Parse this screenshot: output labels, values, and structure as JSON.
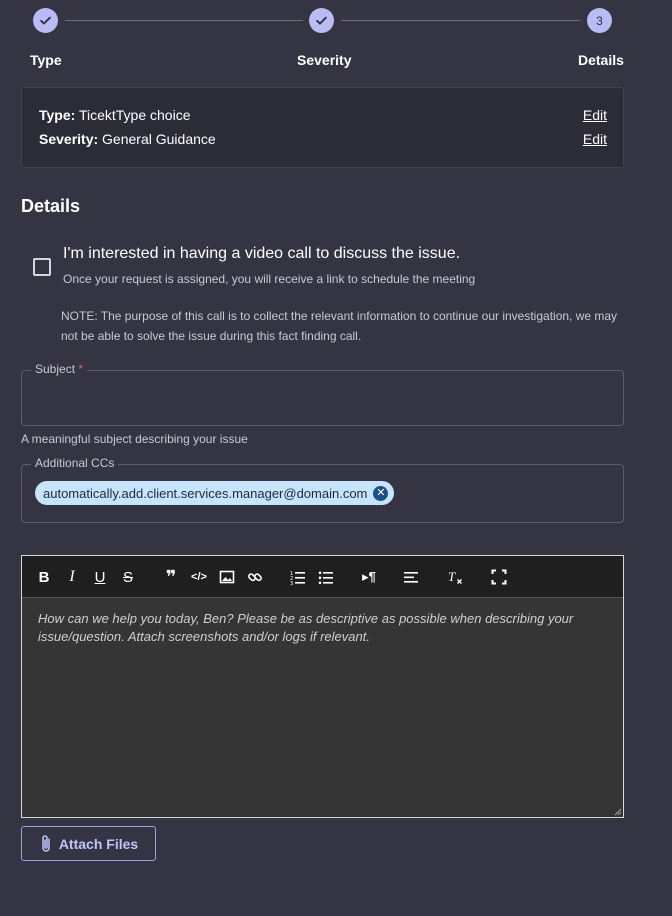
{
  "stepper": {
    "steps": [
      {
        "label": "Type",
        "state": "complete"
      },
      {
        "label": "Severity",
        "state": "complete"
      },
      {
        "label": "Details",
        "state": "current",
        "number": "3"
      }
    ]
  },
  "summary": {
    "type_key": "Type:",
    "type_value": " TicektType choice",
    "severity_key": "Severity:",
    "severity_value": " General Guidance",
    "edit_label": "Edit"
  },
  "details": {
    "title": "Details",
    "video_call": {
      "label": "I'm interested in having a video call to discuss the issue.",
      "sublabel": "Once your request is assigned, you will receive a link to schedule the meeting",
      "checked": false
    },
    "note": "NOTE: The purpose of this call is to collect the relevant information to continue our investigation, we may not be able to solve the issue during this fact finding call."
  },
  "subject": {
    "label": "Subject",
    "required_mark": "*",
    "value": "",
    "helper": "A meaningful subject describing your issue"
  },
  "ccs": {
    "label": "Additional CCs",
    "chips": [
      "automatically.add.client.services.manager@domain.com"
    ]
  },
  "editor": {
    "placeholder": "How can we help you today, Ben? Please be as descriptive as possible when describing your issue/question. Attach screenshots and/or logs if relevant.",
    "toolbar": [
      "bold-icon",
      "italic-icon",
      "underline-icon",
      "strikethrough-icon",
      "quote-icon",
      "code-icon",
      "image-icon",
      "link-icon",
      "ordered-list-icon",
      "bullet-list-icon",
      "paragraph-direction-icon",
      "align-left-icon",
      "clear-format-icon",
      "fullscreen-icon"
    ]
  },
  "attach": {
    "label": "Attach Files"
  },
  "colors": {
    "background": "#353442",
    "accent": "#b9bcf4",
    "chip": "#c6e4fb"
  }
}
